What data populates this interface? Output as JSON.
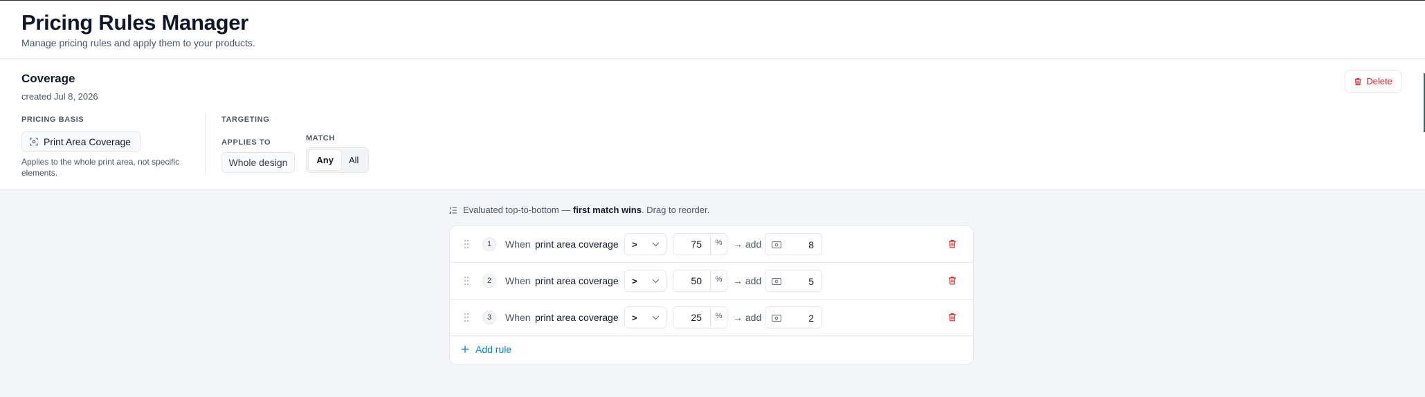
{
  "page": {
    "title": "Pricing Rules Manager",
    "subtitle": "Manage pricing rules and apply them to your products."
  },
  "rule": {
    "name": "Coverage",
    "created": "created Jul 8, 2026",
    "delete_label": "Delete",
    "pricing_basis": {
      "label": "PRICING BASIS",
      "value": "Print Area Coverage",
      "icon": "scan-icon",
      "note": "Applies to the whole print area, not specific elements."
    },
    "targeting": {
      "label": "TARGETING",
      "applies_to_label": "APPLIES TO",
      "applies_to_value": "Whole design",
      "match_label": "MATCH",
      "match_options": [
        "Any",
        "All"
      ],
      "match_selected": "Any"
    }
  },
  "conditions": {
    "note_prefix": "Evaluated top-to-bottom — ",
    "note_bold": "first match wins",
    "note_suffix": ". Drag to reorder.",
    "when_label": "When",
    "add_label": "→ add",
    "add_rule_label": "Add rule",
    "rows": [
      {
        "index": "1",
        "metric": "print area coverage",
        "operator": ">",
        "threshold": "75",
        "unit": "%",
        "amount": "8"
      },
      {
        "index": "2",
        "metric": "print area coverage",
        "operator": ">",
        "threshold": "50",
        "unit": "%",
        "amount": "5"
      },
      {
        "index": "3",
        "metric": "print area coverage",
        "operator": ">",
        "threshold": "25",
        "unit": "%",
        "amount": "2"
      }
    ]
  },
  "colors": {
    "danger": "#dc2626",
    "link": "#0284c7",
    "accent": "#0f766e"
  }
}
